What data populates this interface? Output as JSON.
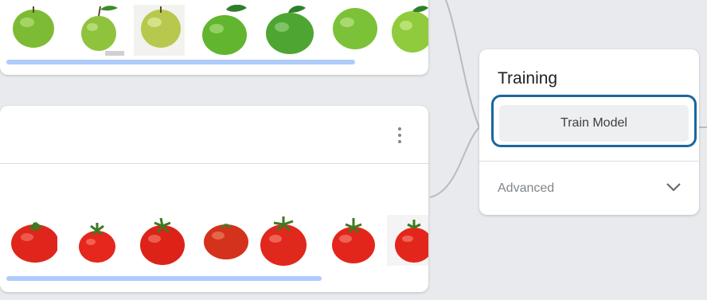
{
  "training": {
    "title": "Training",
    "train_button_label": "Train Model",
    "advanced_label": "Advanced"
  },
  "classes": [
    {
      "kind": "apple",
      "sample_count": 7
    },
    {
      "kind": "tomato",
      "sample_count": 7
    }
  ],
  "colors": {
    "background": "#e8eaed",
    "card": "#ffffff",
    "scrollbar": "#aecbfa",
    "focus_ring": "#1967a0",
    "button_bg": "#eeeff1",
    "connector": "#b8bcc2"
  },
  "icons": [
    "more-vert-icon",
    "chevron-down-icon",
    "apple-image",
    "tomato-image"
  ]
}
